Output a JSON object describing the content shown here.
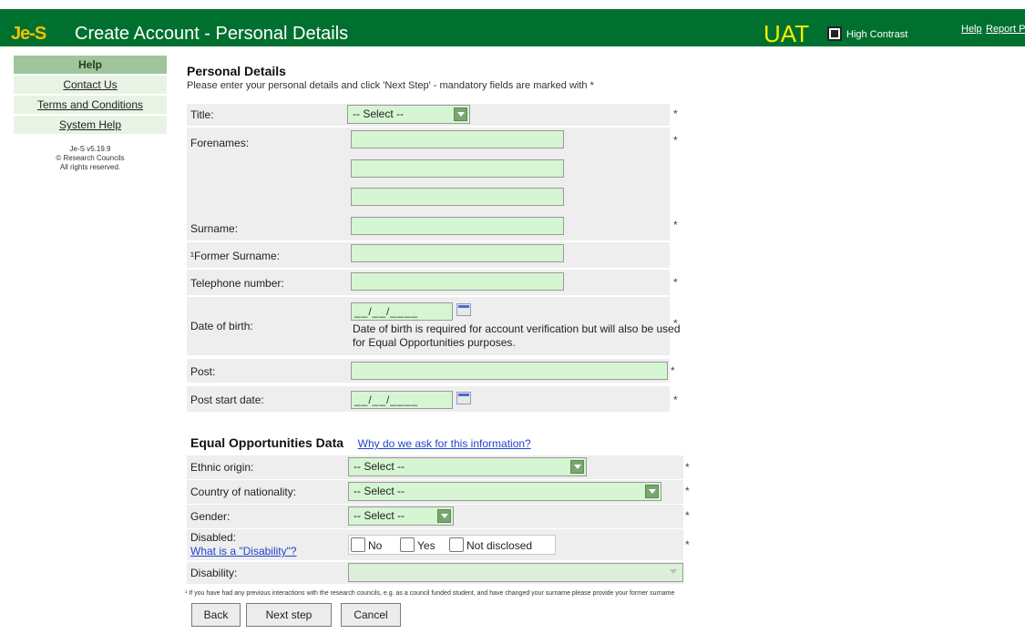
{
  "header": {
    "logo": "Je-S",
    "title": "Create Account - Personal Details",
    "env": "UAT",
    "high_contrast_label": "High Contrast",
    "help_link": "Help",
    "report_link": "Report Pro",
    "background": "#00702f"
  },
  "sidebar": {
    "heading": "Help",
    "items": [
      {
        "label": "Contact Us"
      },
      {
        "label": "Terms and Conditions"
      },
      {
        "label": "System Help"
      }
    ],
    "meta": [
      "Je-S v5.19.9",
      "© Research Councils",
      "All rights reserved."
    ]
  },
  "personal": {
    "section_title": "Personal Details",
    "intro": "Please enter your personal details and click 'Next Step' - mandatory fields are marked with *",
    "title_label": "Title:",
    "title_value": "-- Select --",
    "forenames_label": "Forenames:",
    "surname_label": "Surname:",
    "former_surname_label": "¹Former Surname:",
    "telephone_label": "Telephone number:",
    "dob_label": "Date of birth:",
    "dob_value": "__/__/____",
    "dob_note": "Date of birth is required for account verification but will also be used for Equal Opportunities purposes.",
    "post_label": "Post:",
    "post_start_label": "Post start date:",
    "post_start_value": "__/__/____",
    "required_mark": "*"
  },
  "equal_opps": {
    "section_title": "Equal Opportunities Data",
    "why_link": "Why do we ask for this information?",
    "ethnic_label": "Ethnic origin:",
    "ethnic_value": "-- Select --",
    "nationality_label": "Country of nationality:",
    "nationality_value": "-- Select --",
    "gender_label": "Gender:",
    "gender_value": "-- Select --",
    "disabled_label": "Disabled:",
    "disability_link": "What is a \"Disability\"?",
    "radio_no": "No",
    "radio_yes": "Yes",
    "radio_nd": "Not disclosed",
    "disability_label": "Disability:",
    "disability_value": ""
  },
  "footnote": "¹ If you have had any previous interactions with the research councils, e.g. as a council funded student, and have changed your surname please provide your former surname",
  "buttons": {
    "back": "Back",
    "next": "Next step",
    "cancel": "Cancel"
  }
}
